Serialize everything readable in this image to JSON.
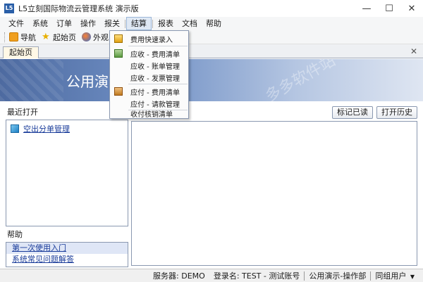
{
  "window": {
    "icon_label": "L5",
    "title": "L5立刻国际物流云管理系统 演示版",
    "minimize": "—",
    "maximize": "☐",
    "close": "✕"
  },
  "menubar": {
    "items": [
      "文件",
      "系统",
      "订单",
      "操作",
      "报关",
      "结算",
      "报表",
      "文档",
      "帮助"
    ],
    "active": "结算"
  },
  "toolbar": {
    "nav_label": "导航",
    "home_label": "起始页",
    "look_label": "外观"
  },
  "tabs": {
    "active_label": "起始页",
    "close_glyph": "✕"
  },
  "banner": {
    "title": "公用演",
    "watermark": "多多软件站"
  },
  "left_panel": {
    "recent_heading": "最近打开",
    "recent_items": [
      "空出分单管理"
    ],
    "help_heading": "帮助",
    "help_items": [
      "第一次使用入门",
      "系统常见问题解答"
    ]
  },
  "right_panel": {
    "mark_read_label": "标记已读",
    "open_history_label": "打开历史"
  },
  "statusbar": {
    "server": "服务器: DEMO",
    "login": "登录名: TEST - 测试账号",
    "company": "公用演示-操作部",
    "sync_user": "同组用户",
    "arrow": "▼"
  },
  "dropdown": {
    "items": [
      {
        "label": "费用快速录入",
        "icon": "fast-entry-icon"
      },
      {
        "label": "应收 - 费用清单",
        "icon": "receivable-icon"
      },
      {
        "label": "应收 - 账单管理",
        "icon": ""
      },
      {
        "label": "应收 - 发票管理",
        "icon": ""
      },
      {
        "label": "应付 - 费用清单",
        "icon": "payable-icon"
      },
      {
        "label": "应付 - 请款管理",
        "icon": ""
      },
      {
        "label": "收付核销清单",
        "icon": ""
      }
    ]
  },
  "colors": {
    "banner_start": "#4d6aa0",
    "banner_end": "#dfe6f2",
    "link": "#1a3c9a"
  }
}
